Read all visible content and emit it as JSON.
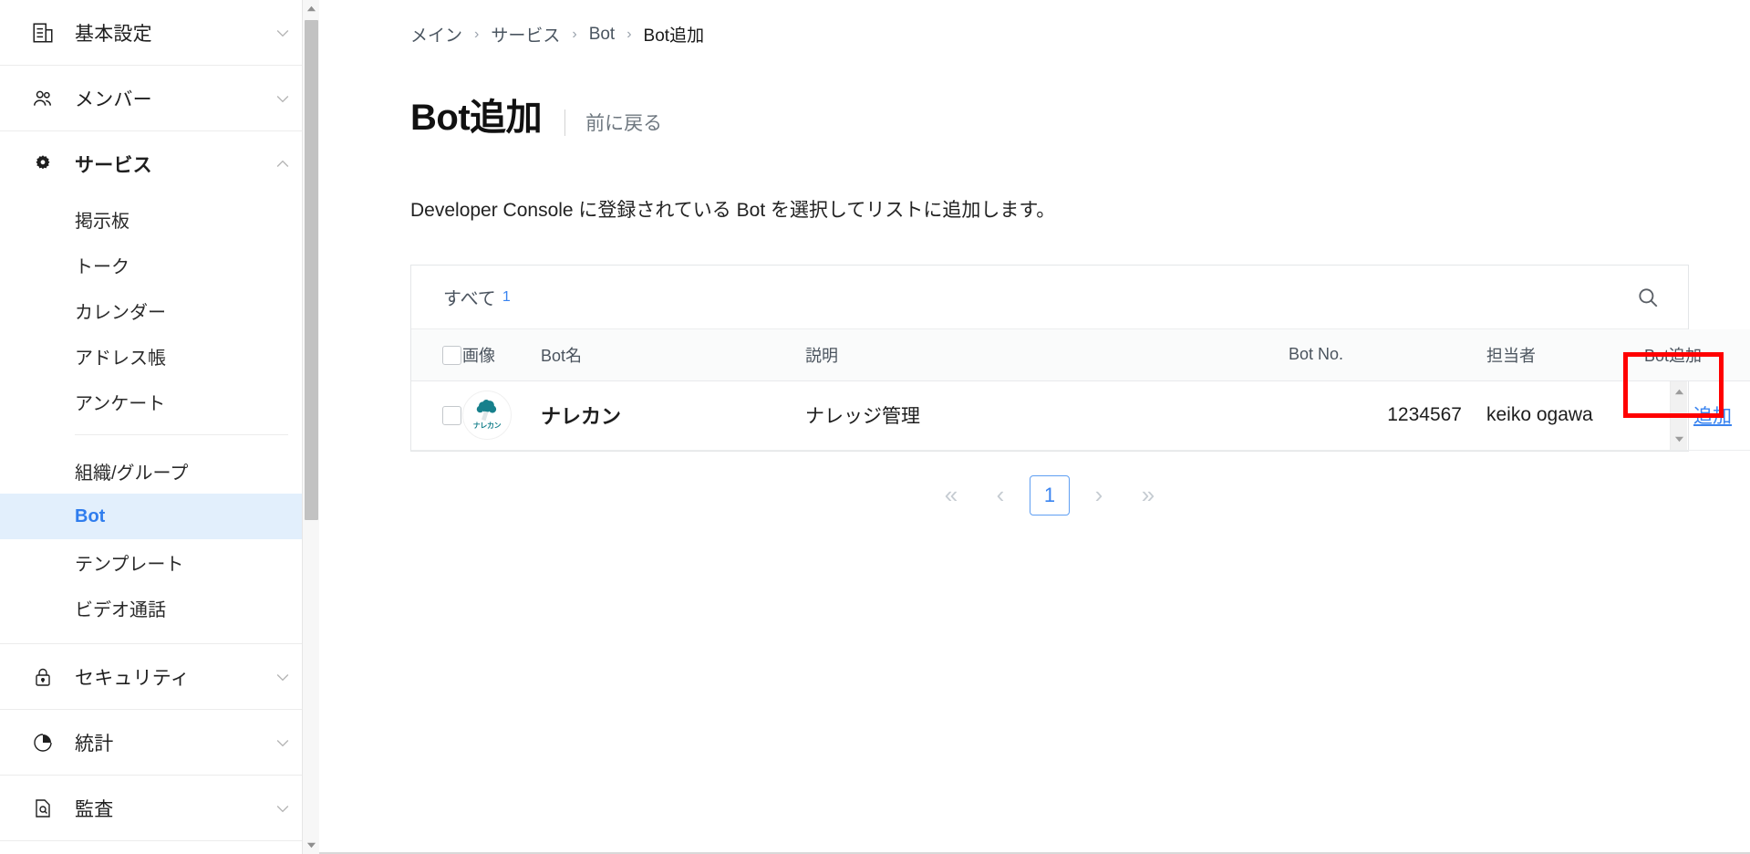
{
  "sidebar": {
    "groups": [
      {
        "icon": "document-settings-icon",
        "label": "基本設定",
        "expanded": false
      },
      {
        "icon": "members-icon",
        "label": "メンバー",
        "expanded": false
      },
      {
        "icon": "gear-icon",
        "label": "サービス",
        "expanded": true
      },
      {
        "icon": "lock-icon",
        "label": "セキュリティ",
        "expanded": false
      },
      {
        "icon": "pie-chart-icon",
        "label": "統計",
        "expanded": false
      },
      {
        "icon": "audit-icon",
        "label": "監査",
        "expanded": false
      }
    ],
    "service_items": [
      {
        "label": "掲示板",
        "selected": false
      },
      {
        "label": "トーク",
        "selected": false
      },
      {
        "label": "カレンダー",
        "selected": false
      },
      {
        "label": "アドレス帳",
        "selected": false
      },
      {
        "label": "アンケート",
        "selected": false
      }
    ],
    "service_items2": [
      {
        "label": "組織/グループ",
        "selected": false
      },
      {
        "label": "Bot",
        "selected": true
      },
      {
        "label": "テンプレート",
        "selected": false
      },
      {
        "label": "ビデオ通話",
        "selected": false
      }
    ],
    "selected_accent": "#2f7dee",
    "selected_bg": "#e2effc"
  },
  "breadcrumb": {
    "items": [
      "メイン",
      "サービス",
      "Bot",
      "Bot追加"
    ],
    "separator": "›"
  },
  "header": {
    "title": "Bot追加",
    "back_link": "前に戻る"
  },
  "description": "Developer Console に登録されている Bot を選択してリストに追加します。",
  "toolbar": {
    "filter_label": "すべて",
    "filter_count": "1",
    "search_icon": "search-icon"
  },
  "table": {
    "columns": [
      "画像",
      "Bot名",
      "説明",
      "Bot No.",
      "担当者",
      "Bot追加"
    ],
    "rows": [
      {
        "checked": false,
        "avatar_brand": "ナレカン",
        "avatar_color": "#17808c",
        "name": "ナレカン",
        "description": "ナレッジ管理",
        "bot_no": "1234567",
        "owner": "keiko ogawa",
        "action_label": "追加",
        "action_highlighted": true
      }
    ]
  },
  "pagination": {
    "first": "«",
    "prev": "‹",
    "pages": [
      "1"
    ],
    "current": "1",
    "next": "›",
    "last": "»"
  },
  "annotation": {
    "highlight_color": "#ff0000",
    "target": "追加"
  }
}
